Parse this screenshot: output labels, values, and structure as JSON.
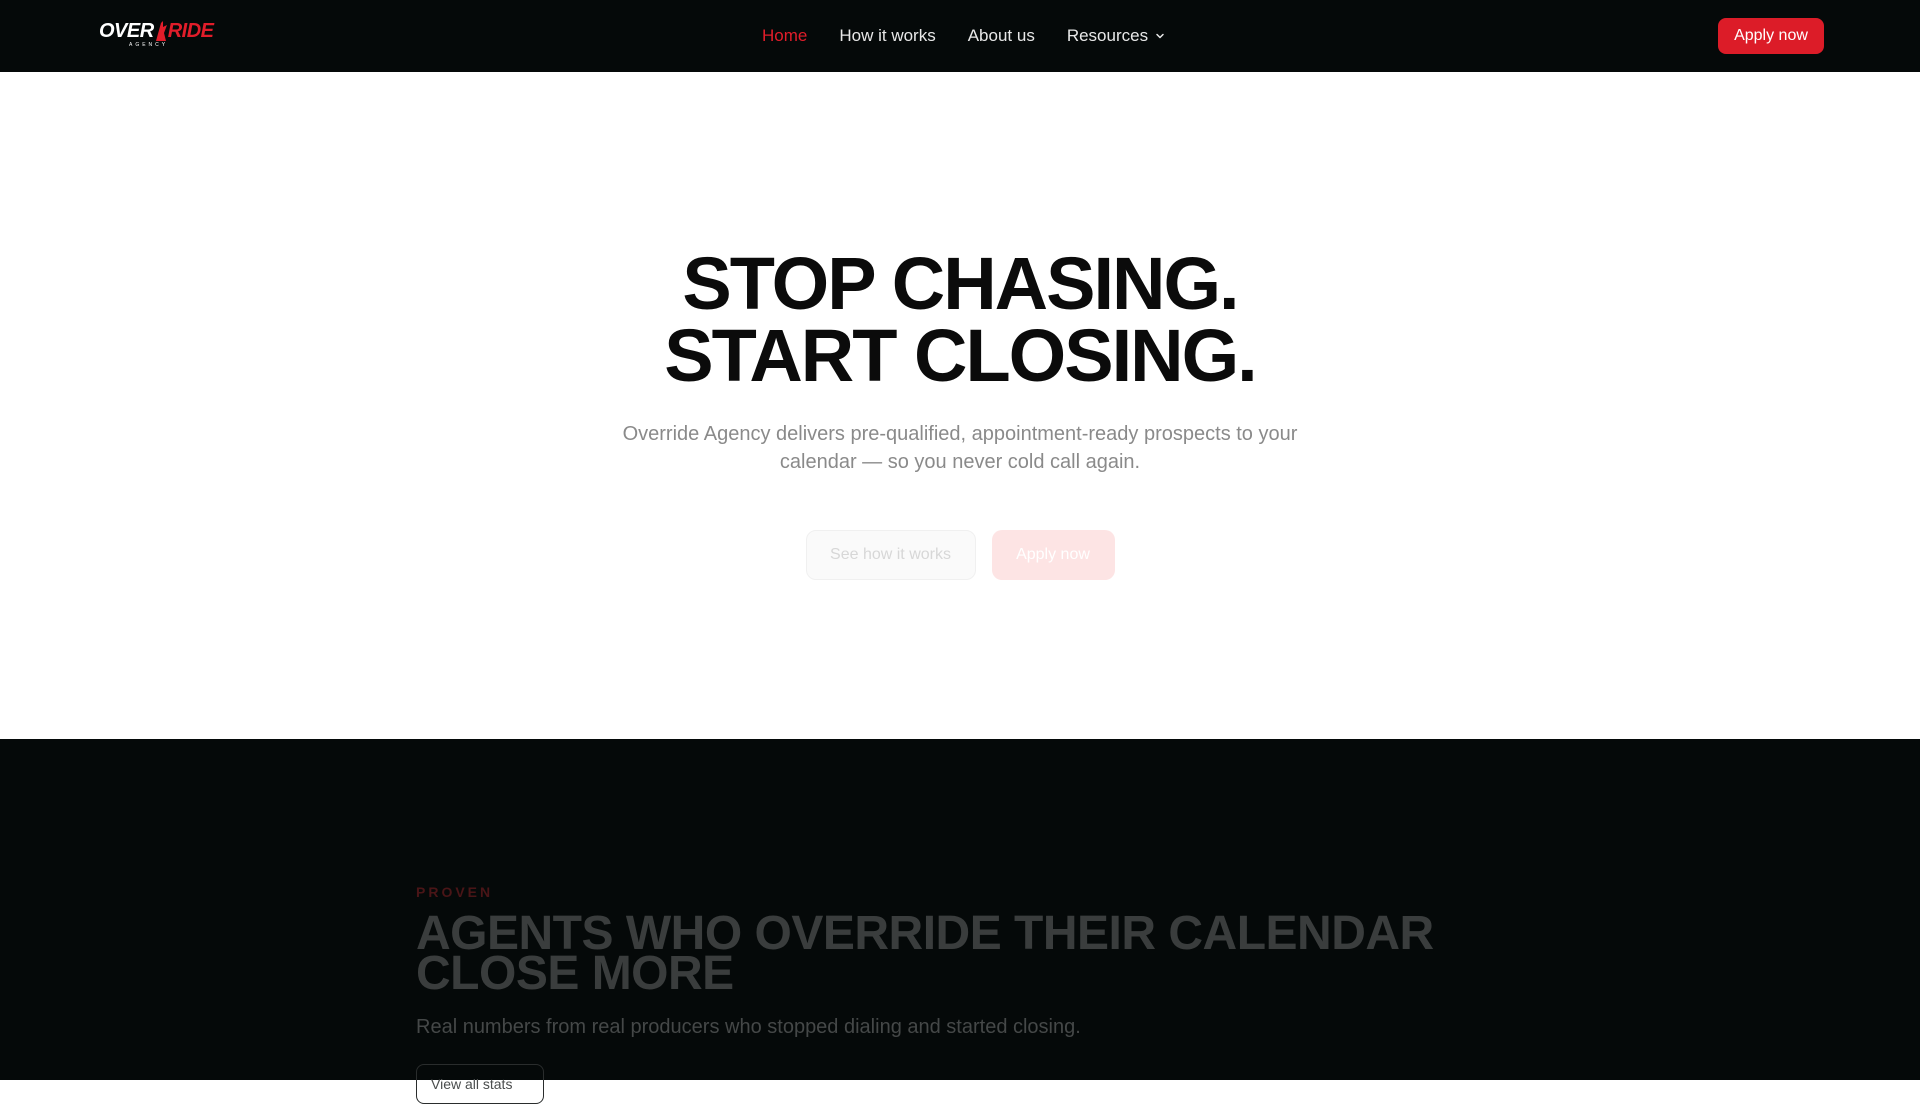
{
  "brand": {
    "logo_word_left": "OVER",
    "logo_word_right": "RIDE",
    "logo_sub": "AGENCY",
    "accent_color": "#e11d2a"
  },
  "nav": {
    "links": [
      {
        "label": "Home",
        "active": true
      },
      {
        "label": "How it works",
        "active": false
      },
      {
        "label": "About us",
        "active": false
      },
      {
        "label": "Resources",
        "active": false,
        "has_dropdown": true
      }
    ],
    "apply_label": "Apply now"
  },
  "hero": {
    "title_line1": "STOP CHASING.",
    "title_line2": "START CLOSING.",
    "subtitle": "Override Agency delivers pre-qualified, appointment-ready prospects to your calendar — so you never cold call again.",
    "secondary_button": "See how it works",
    "primary_button": "Apply now"
  },
  "proven": {
    "eyebrow": "PROVEN",
    "title": "AGENTS WHO OVERRIDE THEIR CALENDAR CLOSE MORE",
    "subtitle": "Real numbers from real producers who stopped dialing and started closing.",
    "button": "View all stats"
  }
}
